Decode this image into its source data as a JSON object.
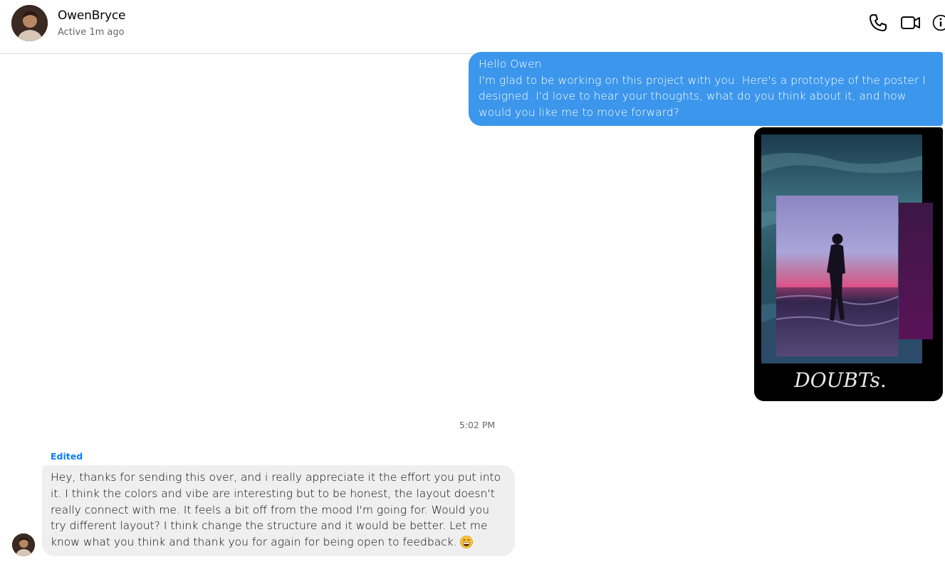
{
  "header": {
    "contact_name": "OwenBryce",
    "status": "Active 1m ago",
    "icons": [
      "phone-icon",
      "video-call-icon",
      "info-icon"
    ]
  },
  "messages": {
    "outgoing": {
      "greeting": "Hello Owen",
      "body": "I'm glad to be working on this project with you. Here's a prototype of the poster I designed. I'd love to hear your thoughts, what do you think about it, and how would you like me to move forward?",
      "attachment": {
        "poster_title": "DOUBTs."
      }
    },
    "timestamp": "5:02 PM",
    "incoming": {
      "edited_label": "Edited",
      "body": "Hey, thanks for sending this over, and i really appreciate it the effort you put into it. I think the colors and vibe are interesting but to be honest, the layout doesn't really connect with me. It feels a bit off from the mood I'm going for. Would you try different layout? I think change the structure and it would be better. Let me know what you think and thank you for again for being open to feedback.",
      "emoji": "grinning-face-emoji"
    }
  },
  "colors": {
    "outgoing_bubble": "#3b96ec",
    "incoming_bubble": "#efefef",
    "edited_label": "#0a7cff"
  }
}
